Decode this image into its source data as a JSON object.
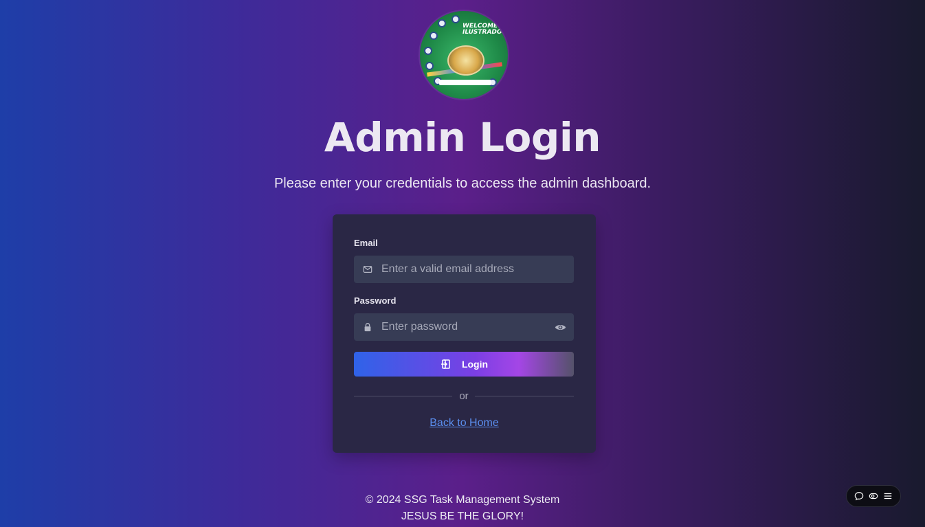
{
  "logo": {
    "text_line1": "WELCOME BA",
    "text_line2": "ILUSTRADOS!"
  },
  "header": {
    "title": "Admin Login",
    "subtitle": "Please enter your credentials to access the admin dashboard."
  },
  "form": {
    "email_label": "Email",
    "email_value": "",
    "email_placeholder": "Enter a valid email address",
    "password_label": "Password",
    "password_value": "",
    "password_placeholder": "Enter password",
    "login_label": "Login",
    "divider_text": "or",
    "back_link": "Back to Home"
  },
  "icons": {
    "email": "mail-icon",
    "password": "lock-icon",
    "reveal": "eye-icon",
    "login": "sign-in-icon"
  },
  "footer": {
    "copyright": "© 2024 SSG Task Management System",
    "tagline": "JESUS BE THE GLORY!"
  },
  "widget": {
    "items": [
      "chat-icon",
      "eye-toggle-icon",
      "menu-icon"
    ]
  },
  "colors": {
    "button_start": "#2f63e8",
    "button_end": "#a446e6",
    "link": "#5b8ff0",
    "card": "#2a2745"
  }
}
